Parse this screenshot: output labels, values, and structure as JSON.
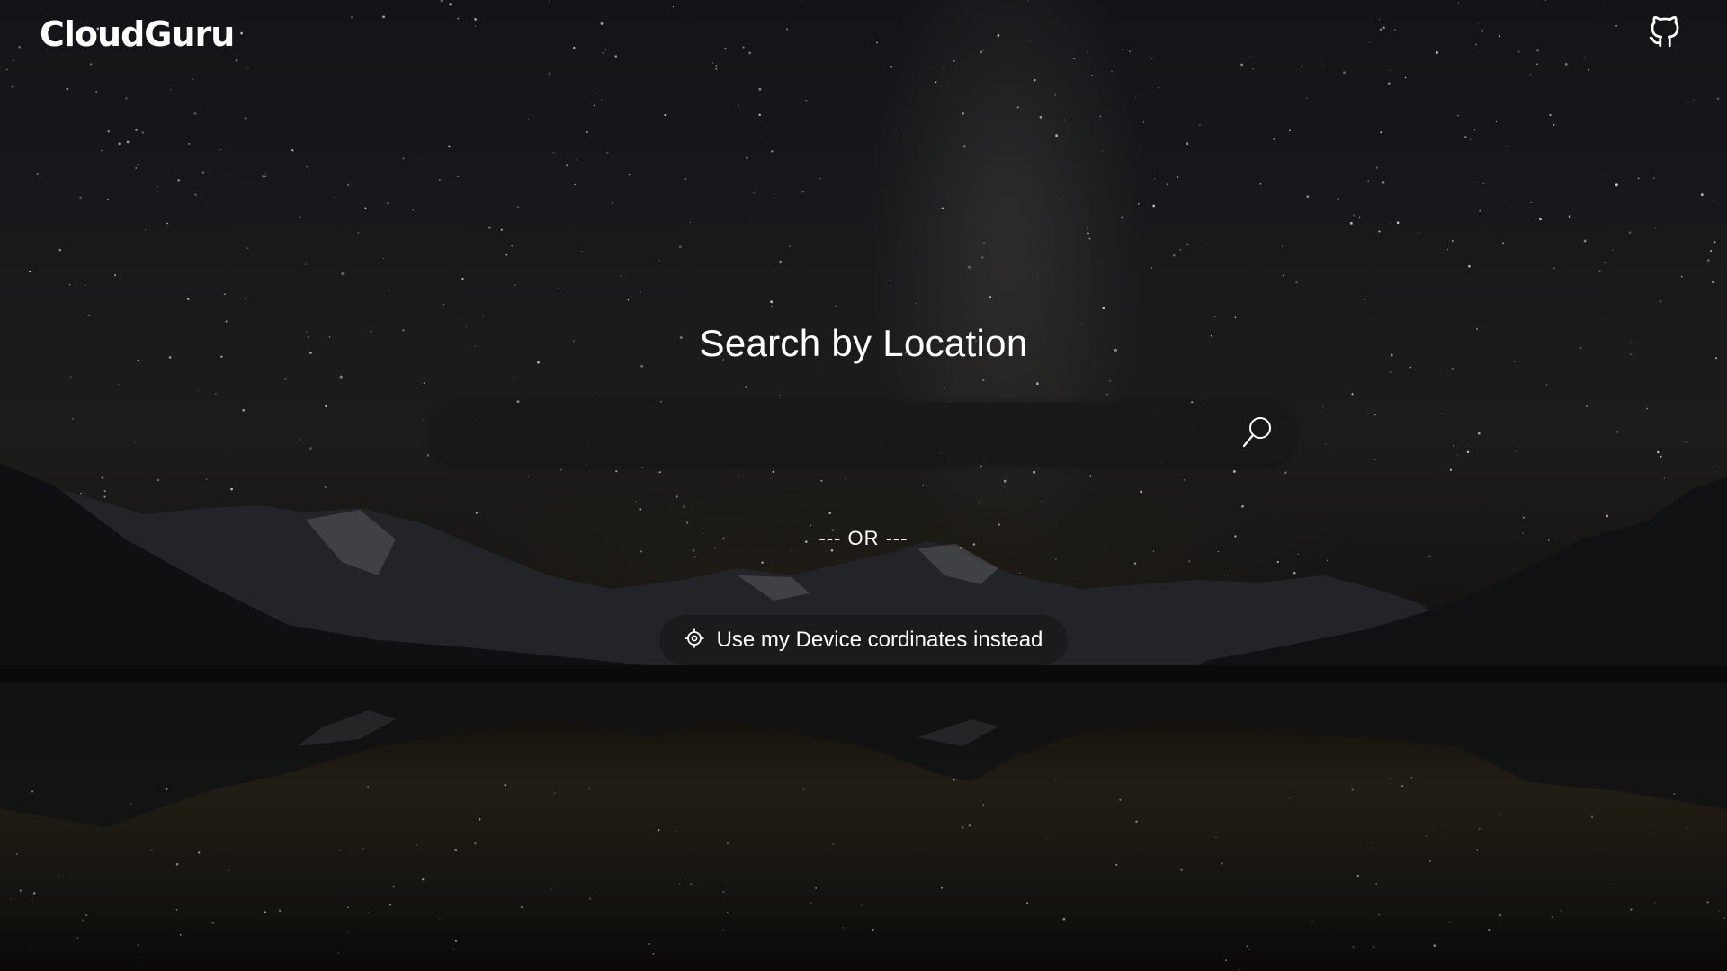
{
  "header": {
    "brand": "CloudGuru",
    "github_icon": "github-icon"
  },
  "main": {
    "title": "Search by Location",
    "search": {
      "value": "",
      "placeholder": "",
      "button_icon": "search-icon"
    },
    "separator": "--- OR ---",
    "device_button": {
      "icon": "location-target-icon",
      "label": "Use my Device cordinates instead"
    }
  },
  "colors": {
    "text": "#ffffff",
    "search_bar": "#181818",
    "background": "#17191d"
  }
}
